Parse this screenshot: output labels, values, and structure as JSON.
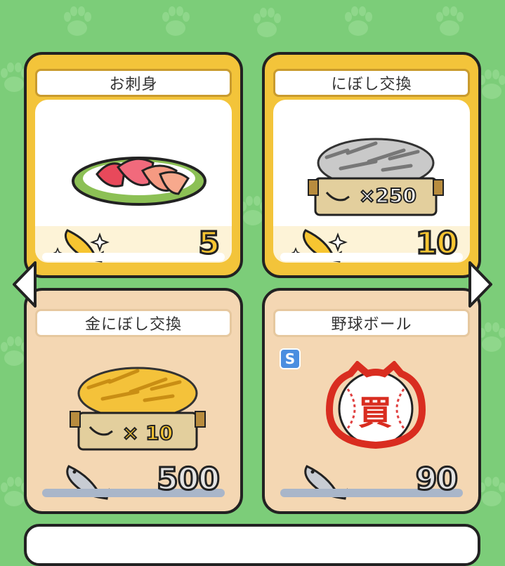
{
  "items": [
    {
      "name": "お刺身",
      "price": "5",
      "currency": "gold-fish"
    },
    {
      "name": "にぼし交換",
      "price": "10",
      "currency": "gold-fish",
      "box_label": "×250"
    },
    {
      "name": "金にぼし交換",
      "price": "500",
      "currency": "silver-fish",
      "box_label": "× 10"
    },
    {
      "name": "野球ボール",
      "price": "90",
      "currency": "silver-fish",
      "badge": "S",
      "stamp": "買"
    }
  ],
  "colors": {
    "background": "#7ccd79",
    "gold_card": "#f3c43a",
    "tan_card": "#f4d7b3"
  }
}
